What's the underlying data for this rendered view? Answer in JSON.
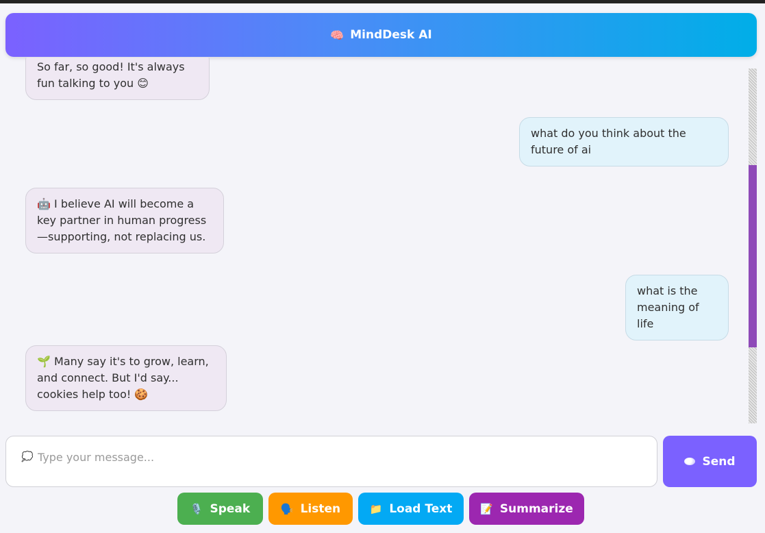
{
  "header": {
    "title": "MindDesk AI",
    "icon": "brain-icon"
  },
  "messages": [
    {
      "role": "bot",
      "text": "So far, so good! It's always fun talking to you 😊"
    },
    {
      "role": "user",
      "text": "what do you think about the future of ai"
    },
    {
      "role": "bot",
      "text": "🤖 I believe AI will become a key partner in human progress—supporting, not replacing us."
    },
    {
      "role": "user",
      "text": "what is the meaning of life"
    },
    {
      "role": "bot",
      "text": "🌱 Many say it's to grow, learn, and connect. But I'd say... cookies help too! 🍪"
    }
  ],
  "composer": {
    "placeholder": "Type your message...",
    "value": "",
    "icon": "speech-bubble-icon"
  },
  "send": {
    "label": "Send",
    "icon": "orb-icon"
  },
  "actions": [
    {
      "label": "Speak",
      "icon": "microphone-icon",
      "color": "#4caf50"
    },
    {
      "label": "Listen",
      "icon": "listening-head-icon",
      "color": "#ff9800"
    },
    {
      "label": "Load Text",
      "icon": "folder-icon",
      "color": "#03a9f4"
    },
    {
      "label": "Summarize",
      "icon": "memo-icon",
      "color": "#9c27b0"
    }
  ],
  "colors": {
    "header_gradient_start": "#7b61ff",
    "header_gradient_end": "#00aee8",
    "bot_bubble": "#efe8f3",
    "user_bubble": "#e1f3fb",
    "send_button": "#7b61ff",
    "scrollbar_thumb": "#8e4ab8"
  }
}
